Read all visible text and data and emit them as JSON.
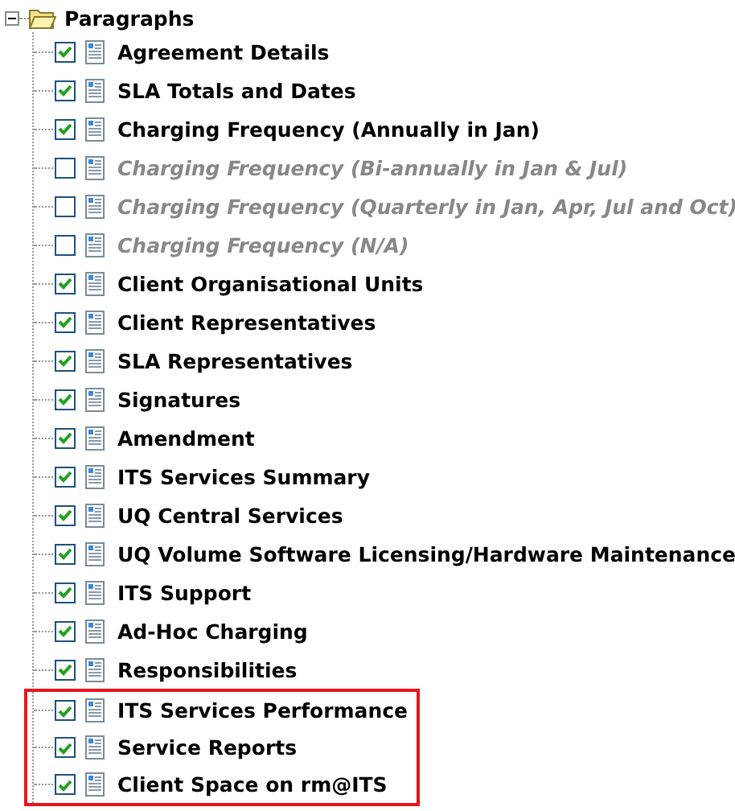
{
  "tree": {
    "label": "Paragraphs",
    "expanded": true,
    "children": [
      {
        "label": "Agreement Details",
        "checked": true,
        "highlighted": false
      },
      {
        "label": "SLA Totals and Dates",
        "checked": true,
        "highlighted": false
      },
      {
        "label": "Charging Frequency (Annually in Jan)",
        "checked": true,
        "highlighted": false
      },
      {
        "label": "Charging Frequency (Bi-annually in Jan & Jul)",
        "checked": false,
        "highlighted": false
      },
      {
        "label": "Charging Frequency (Quarterly in Jan, Apr, Jul and Oct)",
        "checked": false,
        "highlighted": false
      },
      {
        "label": "Charging Frequency (N/A)",
        "checked": false,
        "highlighted": false
      },
      {
        "label": "Client Organisational Units",
        "checked": true,
        "highlighted": false
      },
      {
        "label": "Client Representatives",
        "checked": true,
        "highlighted": false
      },
      {
        "label": "SLA Representatives",
        "checked": true,
        "highlighted": false
      },
      {
        "label": "Signatures",
        "checked": true,
        "highlighted": false
      },
      {
        "label": "Amendment",
        "checked": true,
        "highlighted": false
      },
      {
        "label": "ITS Services Summary",
        "checked": true,
        "highlighted": false
      },
      {
        "label": "UQ Central Services",
        "checked": true,
        "highlighted": false
      },
      {
        "label": "UQ Volume Software Licensing/Hardware Maintenance",
        "checked": true,
        "highlighted": false
      },
      {
        "label": "ITS Support",
        "checked": true,
        "highlighted": false
      },
      {
        "label": "Ad-Hoc Charging",
        "checked": true,
        "highlighted": false
      },
      {
        "label": "Responsibilities",
        "checked": true,
        "highlighted": false
      },
      {
        "label": "ITS Services Performance",
        "checked": true,
        "highlighted": true
      },
      {
        "label": "Service Reports",
        "checked": true,
        "highlighted": true
      },
      {
        "label": "Client Space on rm@ITS",
        "checked": true,
        "highlighted": true
      }
    ]
  }
}
